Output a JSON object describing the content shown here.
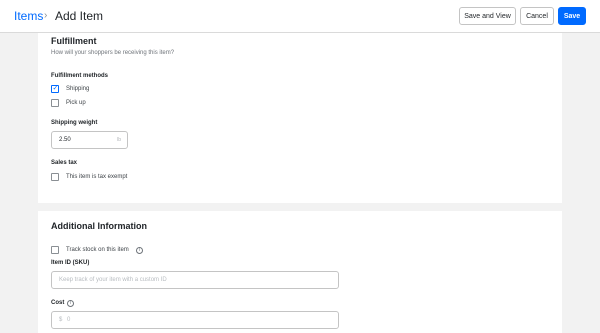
{
  "header": {
    "breadcrumb_root": "Items",
    "breadcrumb_sep": "›",
    "page_title": "Add Item",
    "save_and_view_label": "Save and View",
    "cancel_label": "Cancel",
    "save_label": "Save"
  },
  "fulfillment": {
    "title": "Fulfillment",
    "subtitle": "How will your shoppers be receiving this item?",
    "methods_label": "Fulfillment methods",
    "methods": [
      {
        "label": "Shipping",
        "checked": true
      },
      {
        "label": "Pick up",
        "checked": false
      }
    ],
    "weight_label": "Shipping weight",
    "weight_value": "2.50",
    "weight_unit": "lb",
    "sales_tax_label": "Sales tax",
    "tax_exempt_label": "This item is tax exempt",
    "tax_exempt_checked": false
  },
  "additional": {
    "title": "Additional Information",
    "track_stock_label": "Track stock on this item",
    "track_stock_checked": false,
    "sku_label": "Item ID (SKU)",
    "sku_placeholder": "Keep track of your item with a custom ID",
    "cost_label": "Cost",
    "cost_prefix": "$",
    "cost_value": "0"
  },
  "colors": {
    "accent": "#006aff",
    "background": "#f2f2f2",
    "card": "#ffffff"
  },
  "icons": {
    "check": "checkmark-icon",
    "info": "info-icon"
  }
}
